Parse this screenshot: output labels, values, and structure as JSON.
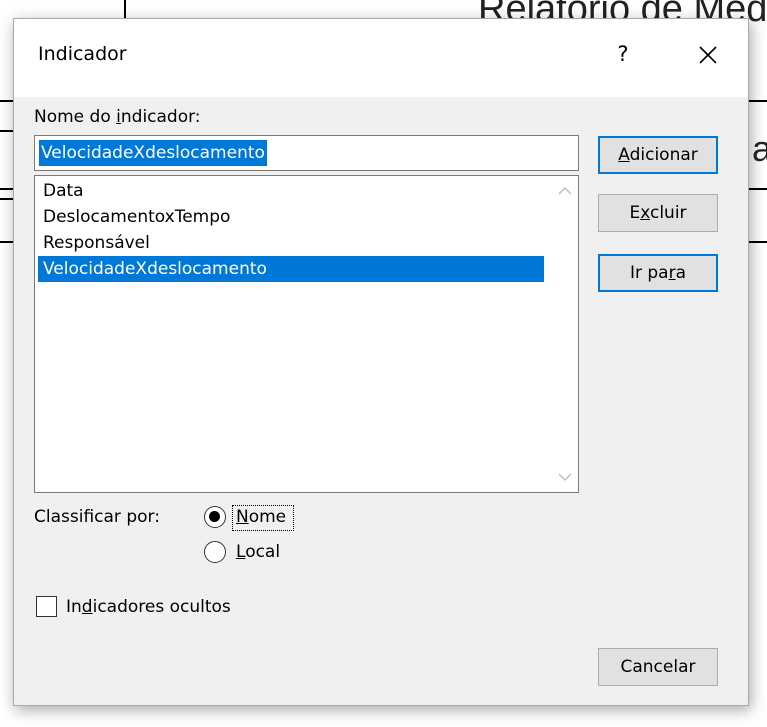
{
  "background_doc": {
    "title_fragment": "Relatório de Med",
    "right_fragment": "a"
  },
  "dialog": {
    "title": "Indicador",
    "help_label": "?",
    "close_icon": "close-icon"
  },
  "name_field": {
    "label_pre": "Nome do ",
    "label_mnemonic": "i",
    "label_post": "ndicador:",
    "value": "VelocidadeXdeslocamento"
  },
  "bookmark_list": {
    "items": [
      "Data",
      "DeslocamentoxTempo",
      "Responsável",
      "VelocidadeXdeslocamento"
    ],
    "selected_index": 3
  },
  "buttons": {
    "add": {
      "pre": "",
      "mnemonic": "A",
      "post": "dicionar"
    },
    "delete": {
      "pre": "E",
      "mnemonic": "x",
      "post": "cluir"
    },
    "goto": {
      "pre": "Ir pa",
      "mnemonic": "r",
      "post": "a"
    },
    "cancel": {
      "label": "Cancelar"
    }
  },
  "sort": {
    "label": "Classificar por:",
    "options": [
      {
        "mnemonic": "N",
        "rest": "ome",
        "checked": true
      },
      {
        "mnemonic": "L",
        "rest": "ocal",
        "checked": false
      }
    ]
  },
  "hidden_bookmarks": {
    "pre": "In",
    "mnemonic": "d",
    "post": "icadores ocultos",
    "checked": false
  },
  "colors": {
    "selection": "#0078d7",
    "dialog_bg": "#f0f0f0",
    "button_bg": "#e1e1e1"
  }
}
